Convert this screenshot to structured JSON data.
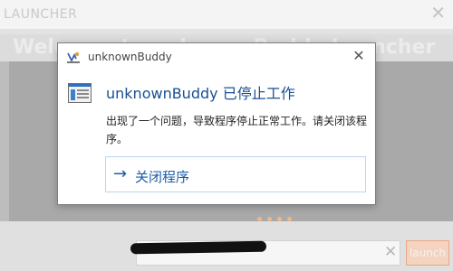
{
  "launcher": {
    "title": "LAUNCHER",
    "close_glyph": "✕",
    "heading": "Welcome to unknownBuddy Launcher",
    "input_clear_glyph": "✕",
    "launch_label": "launch",
    "accent_color": "#e9a888"
  },
  "dialog": {
    "title": "unknownBuddy",
    "close_glyph": "✕",
    "heading": "unknownBuddy 已停止工作",
    "message": "出现了一个问题，导致程序停止正常工作。请关闭该程序。",
    "close_program": {
      "arrow_glyph": "→",
      "label": "关闭程序"
    },
    "heading_color": "#1a4f93"
  }
}
